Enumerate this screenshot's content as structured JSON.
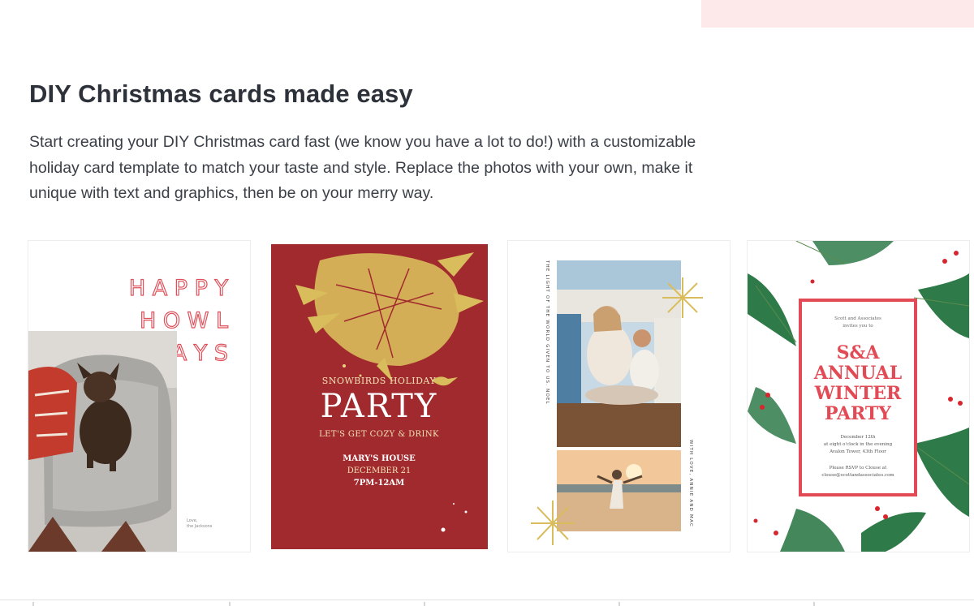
{
  "section": {
    "heading": "DIY Christmas cards made easy",
    "intro": "Start creating your DIY Christmas card fast (we know you have a lot to do!) with a customizable holiday card template to match your taste and style. Replace the photos with your own, make it unique with text and graphics, then be on your merry way."
  },
  "colors": {
    "accent_pink": "#fde9ea",
    "card_red": "#a12a2e",
    "gold": "#d9bd5c",
    "frame_red": "#e24b55"
  },
  "cards": [
    {
      "name": "Happy Howl Idays",
      "lines": [
        "H A P P Y",
        "H O W L",
        "I D A Y S"
      ],
      "footer": [
        "Love,",
        "the Jacksons"
      ]
    },
    {
      "name": "Snowbirds Holiday Party",
      "kicker": "SNOWBIRDS HOLIDAY",
      "title": "PARTY",
      "tagline": "LET'S GET COZY & DRINK",
      "place": "MARY'S HOUSE",
      "date": "DECEMBER 21",
      "time": "7PM-12AM"
    },
    {
      "name": "Light of the World",
      "side_left": "THE LIGHT OF THE WORLD GIVEN TO US. NOEL",
      "side_right": "WITH LOVE, ANNIE AND MAC"
    },
    {
      "name": "S&A Annual Winter Party",
      "host": [
        "Scott and Associates",
        "invites you to"
      ],
      "title": [
        "S&A",
        "ANNUAL",
        "WINTER",
        "PARTY"
      ],
      "details": [
        "December 12th",
        "at eight o'clock in the evening",
        "Avalon Tower, 43th Floor"
      ],
      "rsvp": [
        "Please RSVP to Clouse at",
        "clouse@scottandassociates.com"
      ]
    }
  ]
}
